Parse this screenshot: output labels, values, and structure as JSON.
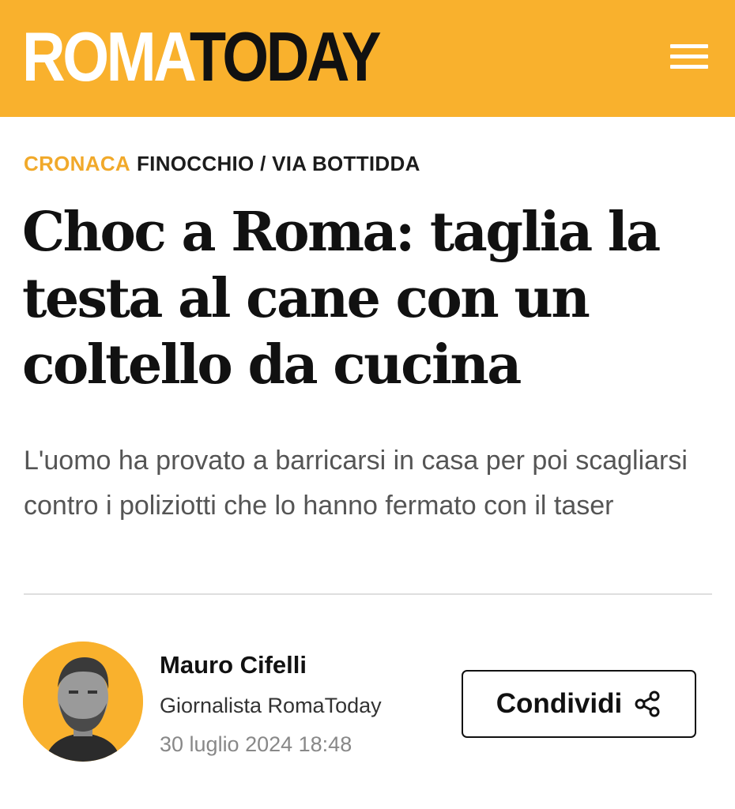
{
  "header": {
    "logo_part1": "ROMA",
    "logo_part2": "TODAY",
    "menu_icon": "hamburger-menu-icon",
    "background_color": "#F9B12D"
  },
  "breadcrumb": {
    "category": "CRONACA",
    "location": "FINOCCHIO / VIA BOTTIDDA"
  },
  "article": {
    "headline": "Choc a Roma: taglia la testa al cane con un coltello da cucina",
    "subtitle": "L'uomo ha provato a barricarsi in casa per poi scagliarsi contro i poliziotti che lo hanno fermato con il taser"
  },
  "author": {
    "name": "Mauro Cifelli",
    "role": "Giornalista RomaToday",
    "date": "30 luglio 2024 18:48"
  },
  "share": {
    "label": "Condividi",
    "icon": "share-icon"
  },
  "colors": {
    "accent": "#F9B12D",
    "category": "#F1A92A"
  }
}
